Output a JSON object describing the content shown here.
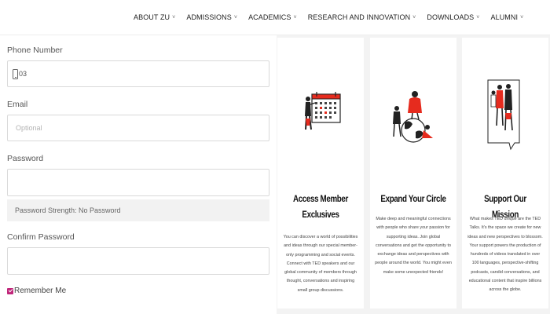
{
  "nav": {
    "items": [
      {
        "label": "ABOUT ZU"
      },
      {
        "label": "ADMISSIONS"
      },
      {
        "label": "ACADEMICS"
      },
      {
        "label": "RESEARCH AND INNOVATION"
      },
      {
        "label": "DOWNLOADS"
      },
      {
        "label": "ALUMNI"
      }
    ],
    "chevron": "˅"
  },
  "form": {
    "phone_label": "Phone Number",
    "phone_value": "03",
    "email_label": "Email",
    "email_placeholder": "Optional",
    "password_label": "Password",
    "password_strength": "Password Strength: No Password",
    "confirm_label": "Confirm Password",
    "remember_label": "Remember Me",
    "remember_checked": true
  },
  "cards": [
    {
      "title": "Access Member Exclusives",
      "description": "You can discover a world of possibilities and ideas through our special member-only programming and social events. Connect with TED speakers and our global community of members through thought, conversations and inspiring small group discussions."
    },
    {
      "title": "Expand Your Circle",
      "description": "Make deep and meaningful connections with people who share your passion for supporting ideas. Join global conversations and get the opportunity to exchange ideas and perspectives with people around the world. You might even make some unexpected friends!"
    },
    {
      "title": "Support Our Mission",
      "description": "What makes TED unique are the TED Talks. It's the space we create for new ideas and new perspectives to blossom. Your support powers the production of hundreds of videos translated in over 100 languages, perspective-shifting podcasts, candid conversations, and educational content that inspire billions across the globe."
    }
  ],
  "colors": {
    "accent": "#c0267a",
    "brand_red": "#e62b1e",
    "panel_bg": "#f3f3f3"
  }
}
